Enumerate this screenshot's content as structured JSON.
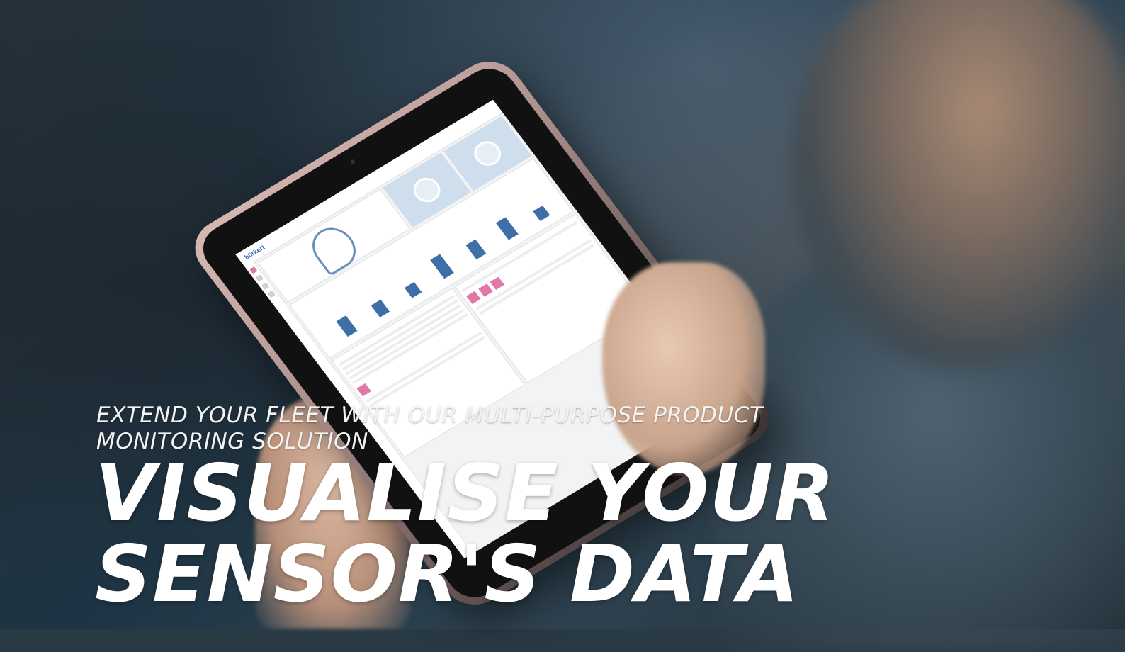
{
  "hero": {
    "subtitle_line1": "EXTEND YOUR FLEET WITH OUR MULTI-PURPOSE PRODUCT",
    "subtitle_line2": "MONITORING SOLUTION",
    "headline_line1": "VISUALISE YOUR",
    "headline_line2": "SENSOR'S DATA"
  },
  "colors": {
    "text": "#ffffff",
    "accent_pink": "#e078a8",
    "bar_blue": "#3e6fa8"
  },
  "tablet_dashboard": {
    "logo": "bürkert",
    "bars": [
      0.45,
      0.35,
      0.3,
      0.55,
      0.42,
      0.5,
      0.28
    ]
  }
}
